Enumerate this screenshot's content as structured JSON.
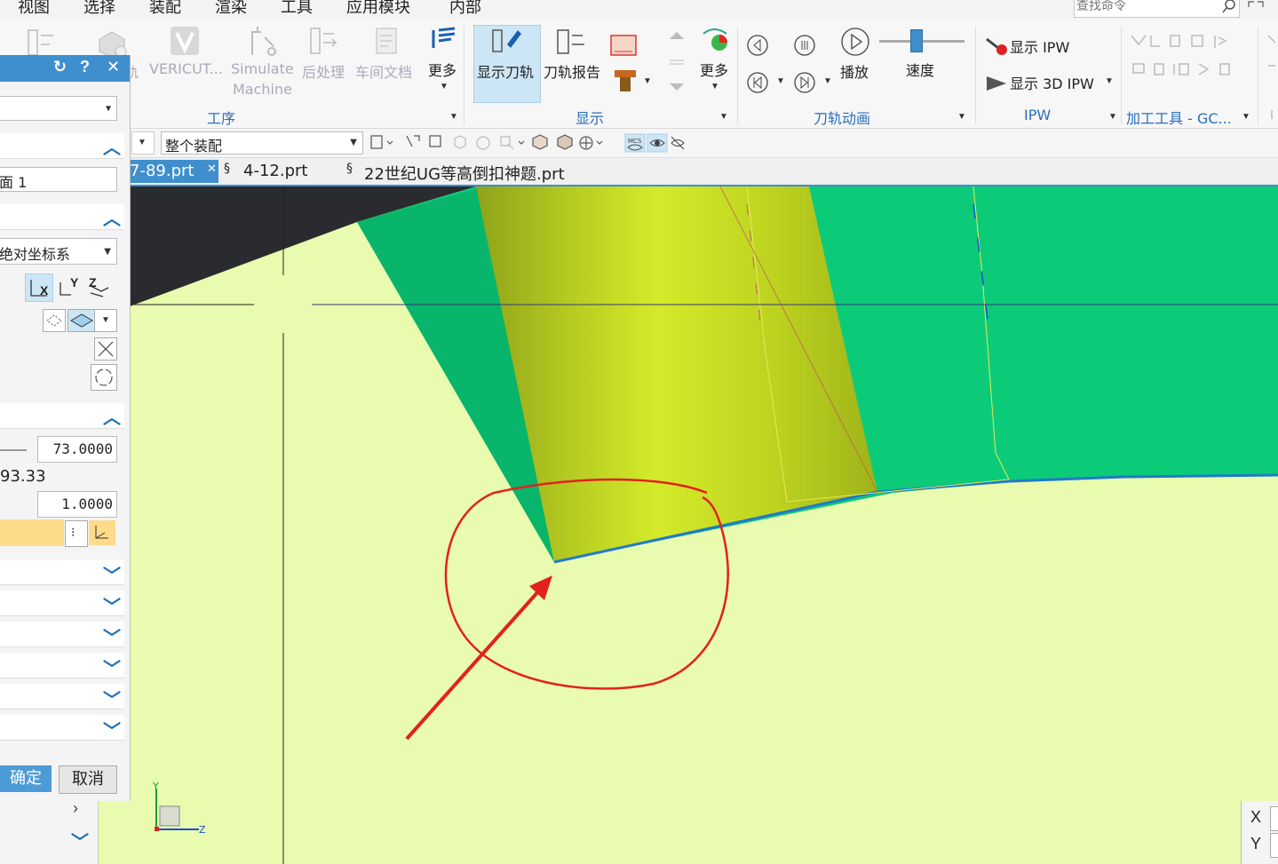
{
  "menu": [
    "视图",
    "选择",
    "装配",
    "渲染",
    "工具",
    "应用模块",
    "内部"
  ],
  "search": {
    "placeholder": "查找命令"
  },
  "ribbon": {
    "group_process": {
      "label": "工序",
      "items": [
        "轨",
        "VERICUT...",
        "Simulate",
        "Machine",
        "后处理",
        "车间文档",
        "更多"
      ]
    },
    "group_display": {
      "label": "显示",
      "items": [
        "显示刀轨",
        "刀轨报告",
        "更多"
      ]
    },
    "group_animation": {
      "label": "刀轨动画",
      "items": [
        "播放",
        "速度"
      ]
    },
    "group_ipw": {
      "label": "IPW",
      "items": [
        "显示 IPW",
        "显示 3D IPW"
      ]
    },
    "group_tools": {
      "label": "加工工具 - GC..."
    },
    "speed": 0.42
  },
  "toolbar": {
    "assembly_select": "整个装配"
  },
  "tabs": [
    "7-89.prt",
    "4-12.prt",
    "22世纪UG等高倒扣神题.prt"
  ],
  "dialog": {
    "face_field": "面 1",
    "coord_select": "绝对坐标系",
    "axis_x": "X",
    "axis_y": "Y",
    "axis_z": "Z",
    "value1": "73.0000",
    "value_label": "93.33",
    "value2": "1.0000",
    "ok": "确定",
    "cancel": "取消"
  },
  "coords": {
    "x": "X",
    "y": "Y"
  },
  "triad": {
    "y": "Y",
    "z": "Z"
  },
  "colors": {
    "background": "#e9fbae",
    "part_green": "#0ccb78",
    "tool_yellow": "#c8df22",
    "dialog_title": "#3f8fce",
    "annotation_red": "#e32020"
  }
}
